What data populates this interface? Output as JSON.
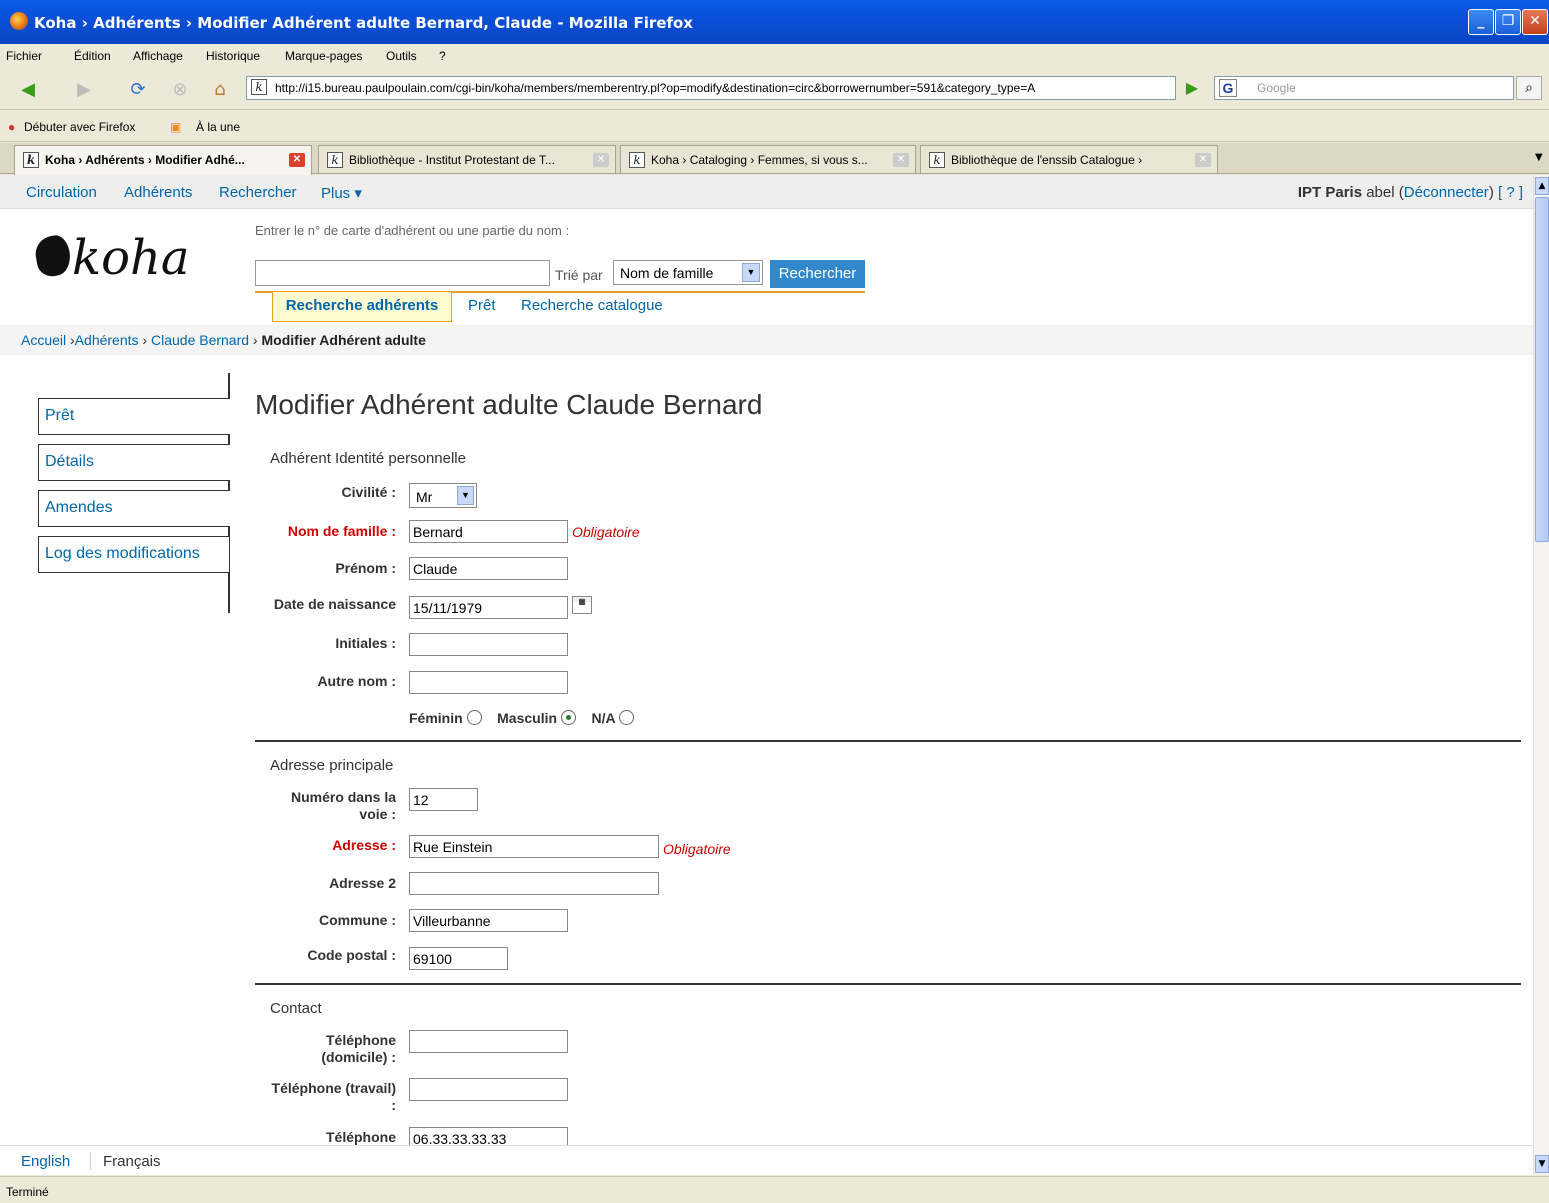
{
  "window": {
    "title": "Koha › Adhérents › Modifier Adhérent adulte Bernard, Claude - Mozilla Firefox"
  },
  "menu": [
    "Fichier",
    "Édition",
    "Affichage",
    "Historique",
    "Marque-pages",
    "Outils",
    "?"
  ],
  "url": "http://i15.bureau.paulpoulain.com/cgi-bin/koha/members/memberentry.pl?op=modify&destination=circ&borrowernumber=591&category_type=A",
  "google_placeholder": "Google",
  "bookmarks": [
    "Débuter avec Firefox",
    "À la une"
  ],
  "tabs": [
    {
      "label": "Koha › Adhérents › Modifier Adhé...",
      "active": true
    },
    {
      "label": "Bibliothèque - Institut Protestant de T...",
      "active": false
    },
    {
      "label": "Koha › Cataloging › Femmes, si vous s...",
      "active": false
    },
    {
      "label": "Bibliothèque de l'enssib Catalogue ›",
      "active": false
    }
  ],
  "topnav": {
    "links": [
      "Circulation",
      "Adhérents",
      "Rechercher",
      "Plus ▾"
    ],
    "library": "IPT Paris",
    "user": "abel",
    "logout": "Déconnecter",
    "help": "[ ? ]"
  },
  "logo": "koha",
  "search": {
    "label": "Entrer le n° de carte d'adhérent ou une partie du nom :",
    "sort_label": "Trié par",
    "sort_value": "Nom de famille",
    "button": "Rechercher",
    "tabs": [
      "Recherche adhérents",
      "Prêt",
      "Recherche catalogue"
    ]
  },
  "breadcrumb": {
    "home": "Accueil",
    "sep": " ›",
    "members": "Adhérents",
    "patron": "Claude Bernard",
    "current": "Modifier Adhérent adulte"
  },
  "leftnav": [
    "Prêt",
    "Détails",
    "Amendes",
    "Log des modifications"
  ],
  "page_title": "Modifier Adhérent adulte Claude Bernard",
  "required_text": "Obligatoire",
  "identity": {
    "legend": "Adhérent Identité personnelle",
    "civilite_label": "Civilité :",
    "civilite_value": "Mr",
    "surname_label": "Nom de famille :",
    "surname_value": "Bernard",
    "firstname_label": "Prénom :",
    "firstname_value": "Claude",
    "dob_label": "Date de naissance",
    "dob_value": "15/11/1979",
    "initials_label": "Initiales :",
    "initials_value": "",
    "othername_label": "Autre nom :",
    "othername_value": "",
    "gender": {
      "female": "Féminin",
      "male": "Masculin",
      "na": "N/A",
      "selected": "male"
    }
  },
  "address": {
    "legend": "Adresse principale",
    "number_label_1": "Numéro dans la",
    "number_label_2": "voie :",
    "number_value": "12",
    "address_label": "Adresse :",
    "address_value": "Rue Einstein",
    "address2_label": "Adresse 2",
    "address2_value": "",
    "city_label": "Commune :",
    "city_value": "Villeurbanne",
    "zip_label": "Code postal :",
    "zip_value": "69100"
  },
  "contact": {
    "legend": "Contact",
    "phone_home_label_1": "Téléphone",
    "phone_home_label_2": "(domicile) :",
    "phone_home_value": "",
    "phone_work_label_1": "Téléphone (travail)",
    "phone_work_label_2": ":",
    "phone_work_value": "",
    "phone_label": "Téléphone",
    "phone_value": "06.33.33.33.33"
  },
  "footer": {
    "english": "English",
    "french": "Français"
  },
  "status": "Terminé"
}
